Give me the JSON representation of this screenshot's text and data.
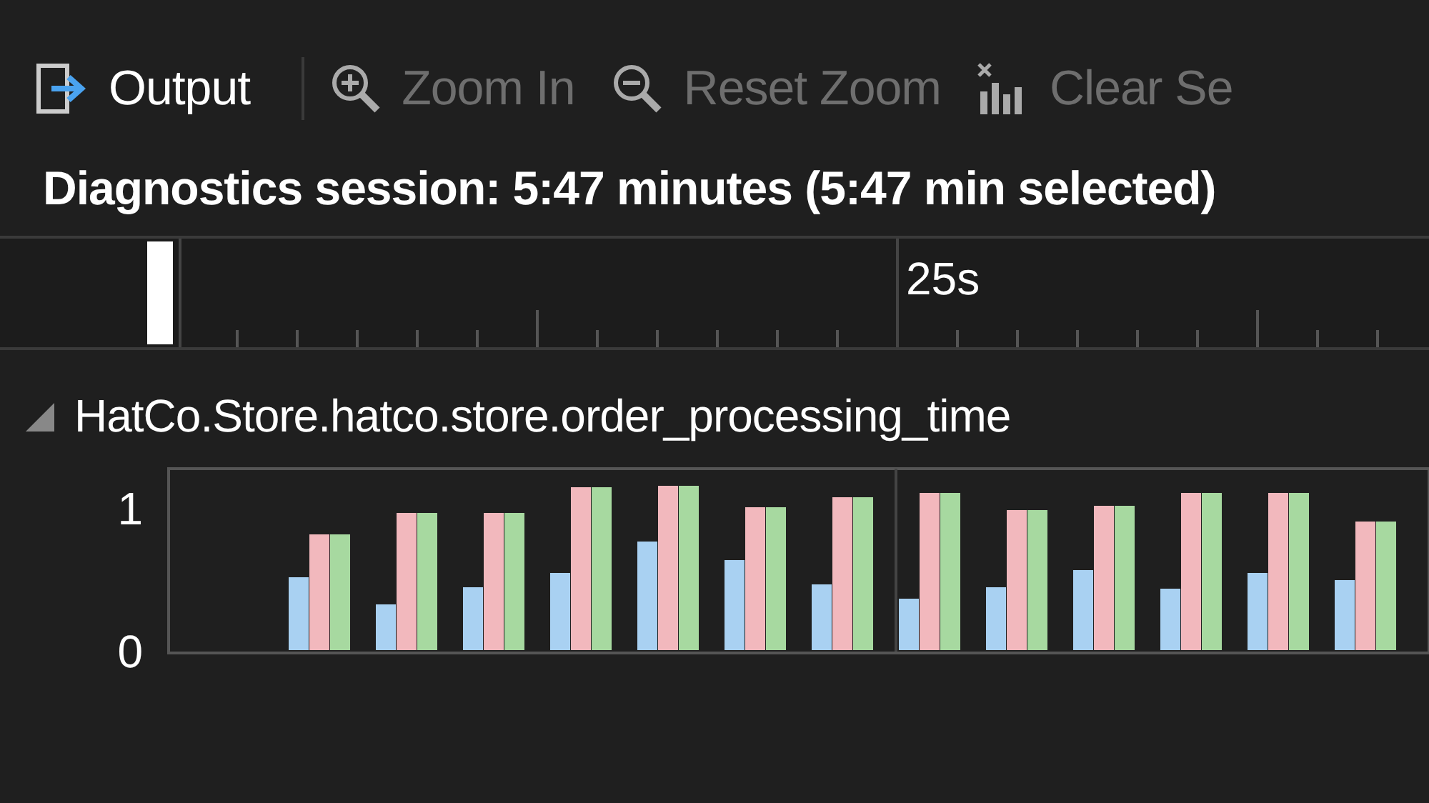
{
  "toolbar": {
    "buttons": [
      {
        "kind": "output",
        "label": "Output",
        "disabled": false
      },
      {
        "kind": "zoom-in",
        "label": "Zoom In",
        "disabled": true
      },
      {
        "kind": "reset-zoom",
        "label": "Reset Zoom",
        "disabled": true
      },
      {
        "kind": "clear",
        "label": "Clear Se",
        "disabled": true
      }
    ]
  },
  "session": {
    "text": "Diagnostics session: 5:47 minutes (5:47 min selected)"
  },
  "ruler": {
    "label": "25s"
  },
  "track": {
    "title": "HatCo.Store.hatco.store.order_processing_time",
    "expanded": true,
    "chart_data": {
      "type": "bar",
      "categories": [
        null,
        null,
        null,
        null,
        null,
        null,
        null,
        null,
        null,
        null,
        null,
        null,
        null
      ],
      "ylim": [
        0,
        1.27
      ],
      "yticks": [
        0,
        1
      ],
      "series": [
        {
          "color": "#a9d1f2",
          "values": [
            0.52,
            0.33,
            0.45,
            0.55,
            0.77,
            0.64,
            0.47,
            0.37,
            0.45,
            0.57,
            0.44,
            0.55,
            0.5
          ]
        },
        {
          "color": "#f2b8bd",
          "values": [
            0.82,
            0.97,
            0.97,
            1.15,
            1.16,
            1.01,
            1.08,
            1.11,
            0.99,
            1.02,
            1.11,
            1.11,
            0.91
          ]
        },
        {
          "color": "#a7d9a0",
          "values": [
            0.82,
            0.97,
            0.97,
            1.15,
            1.16,
            1.01,
            1.08,
            1.11,
            0.99,
            1.02,
            1.11,
            1.11,
            0.91
          ]
        }
      ]
    }
  }
}
